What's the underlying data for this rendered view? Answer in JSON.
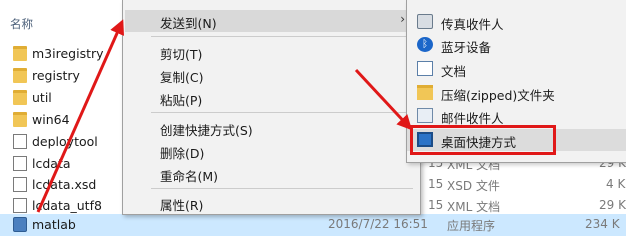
{
  "explorer": {
    "column_name": "名称",
    "files": [
      {
        "name": "m3iregistry",
        "type": "folder"
      },
      {
        "name": "registry",
        "type": "folder"
      },
      {
        "name": "util",
        "type": "folder"
      },
      {
        "name": "win64",
        "type": "folder"
      },
      {
        "name": "deploytool",
        "type": "file"
      },
      {
        "name": "lcdata",
        "type": "file",
        "date_tail": "15",
        "kind": "XML 文档",
        "size": "29 K"
      },
      {
        "name": "lcdata.xsd",
        "type": "file",
        "date_tail": "15",
        "kind": "XSD 文件",
        "size": "4 K"
      },
      {
        "name": "lcdata_utf8",
        "type": "file",
        "date_tail": "15",
        "kind": "XML 文档",
        "size": "29 K"
      },
      {
        "name": "matlab",
        "type": "exe",
        "date": "2016/7/22 16:51",
        "kind": "应用程序",
        "size": "234 K",
        "selected": true
      }
    ]
  },
  "context_menu": {
    "send_to": "发送到(N)",
    "cut": "剪切(T)",
    "copy": "复制(C)",
    "paste": "粘贴(P)",
    "create_shortcut": "创建快捷方式(S)",
    "delete": "删除(D)",
    "rename": "重命名(M)",
    "properties": "属性(R)",
    "submenu_arrow": "›"
  },
  "submenu": {
    "items": [
      {
        "label": "传真收件人",
        "icon": "fax-icon"
      },
      {
        "label": "蓝牙设备",
        "icon": "bluetooth-icon"
      },
      {
        "label": "文档",
        "icon": "documents-icon"
      },
      {
        "label": "压缩(zipped)文件夹",
        "icon": "zip-folder-icon"
      },
      {
        "label": "邮件收件人",
        "icon": "mail-icon"
      },
      {
        "label": "桌面快捷方式",
        "icon": "desktop-icon",
        "highlighted": true
      }
    ]
  },
  "colors": {
    "selection": "#cce8ff",
    "annotation_red": "#e01818"
  }
}
